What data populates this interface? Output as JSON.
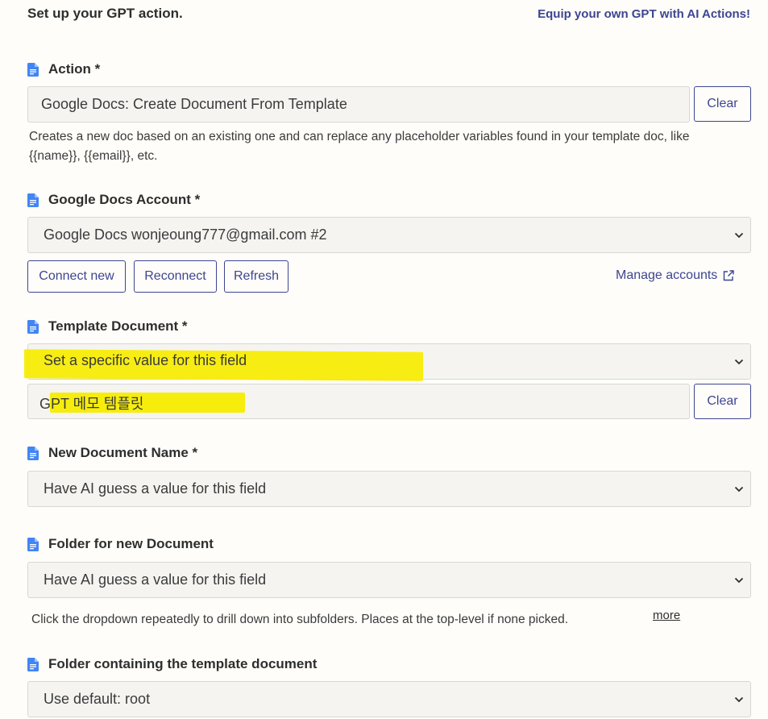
{
  "header": {
    "title": "Set up your GPT action.",
    "link": "Equip your own GPT with AI Actions!"
  },
  "action": {
    "label": "Action *",
    "value": "Google Docs: Create Document From Template",
    "clear": "Clear",
    "help": "Creates a new doc based on an existing one and can replace any placeholder variables found in your template doc, like {{name}}, {{email}}, etc."
  },
  "account": {
    "label": "Google Docs Account *",
    "value": "Google Docs wonjeoung777@gmail.com #2",
    "connect_new": "Connect new",
    "reconnect": "Reconnect",
    "refresh": "Refresh",
    "manage": "Manage accounts"
  },
  "template": {
    "label": "Template Document *",
    "mode": "Set a specific value for this field",
    "value": "GPT 메모 템플릿",
    "clear": "Clear"
  },
  "new_name": {
    "label": "New Document Name *",
    "mode": "Have AI guess a value for this field"
  },
  "folder": {
    "label": "Folder for new Document",
    "mode": "Have AI guess a value for this field",
    "help": "Click the dropdown repeatedly to drill down into subfolders. Places at the top-level if none picked.",
    "more": "more"
  },
  "template_folder": {
    "label": "Folder containing the template document",
    "mode": "Use default: root"
  },
  "colors": {
    "accent": "#3d4592",
    "doc_icon": "#4285f4",
    "highlight": "#f7ec00",
    "background": "#fffdf9"
  }
}
